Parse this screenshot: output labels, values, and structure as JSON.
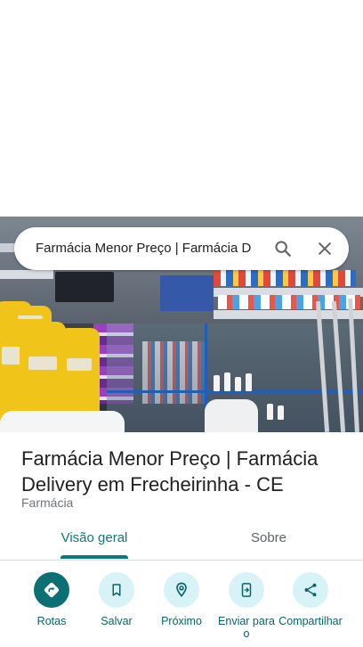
{
  "search": {
    "query": "Farmácia Menor Preço | Farmácia D"
  },
  "place": {
    "title": "Farmácia Menor Preço | Farmácia Delivery em Frecheirinha - CE",
    "category": "Farmácia"
  },
  "tabs": [
    {
      "label": "Visão geral",
      "selected": true
    },
    {
      "label": "Sobre",
      "selected": false
    }
  ],
  "actions": [
    {
      "label": "Rotas",
      "icon": "directions-icon"
    },
    {
      "label": "Salvar",
      "icon": "bookmark-icon"
    },
    {
      "label": "Próximo",
      "icon": "nearby-icon"
    },
    {
      "label": "Enviar para o",
      "icon": "send-to-phone-icon"
    },
    {
      "label": "Compartilhar",
      "icon": "share-icon"
    }
  ],
  "colors": {
    "accent": "#0b7a7d",
    "primary_button": "#0b6f73",
    "tonal_button": "#d8f3f7"
  }
}
